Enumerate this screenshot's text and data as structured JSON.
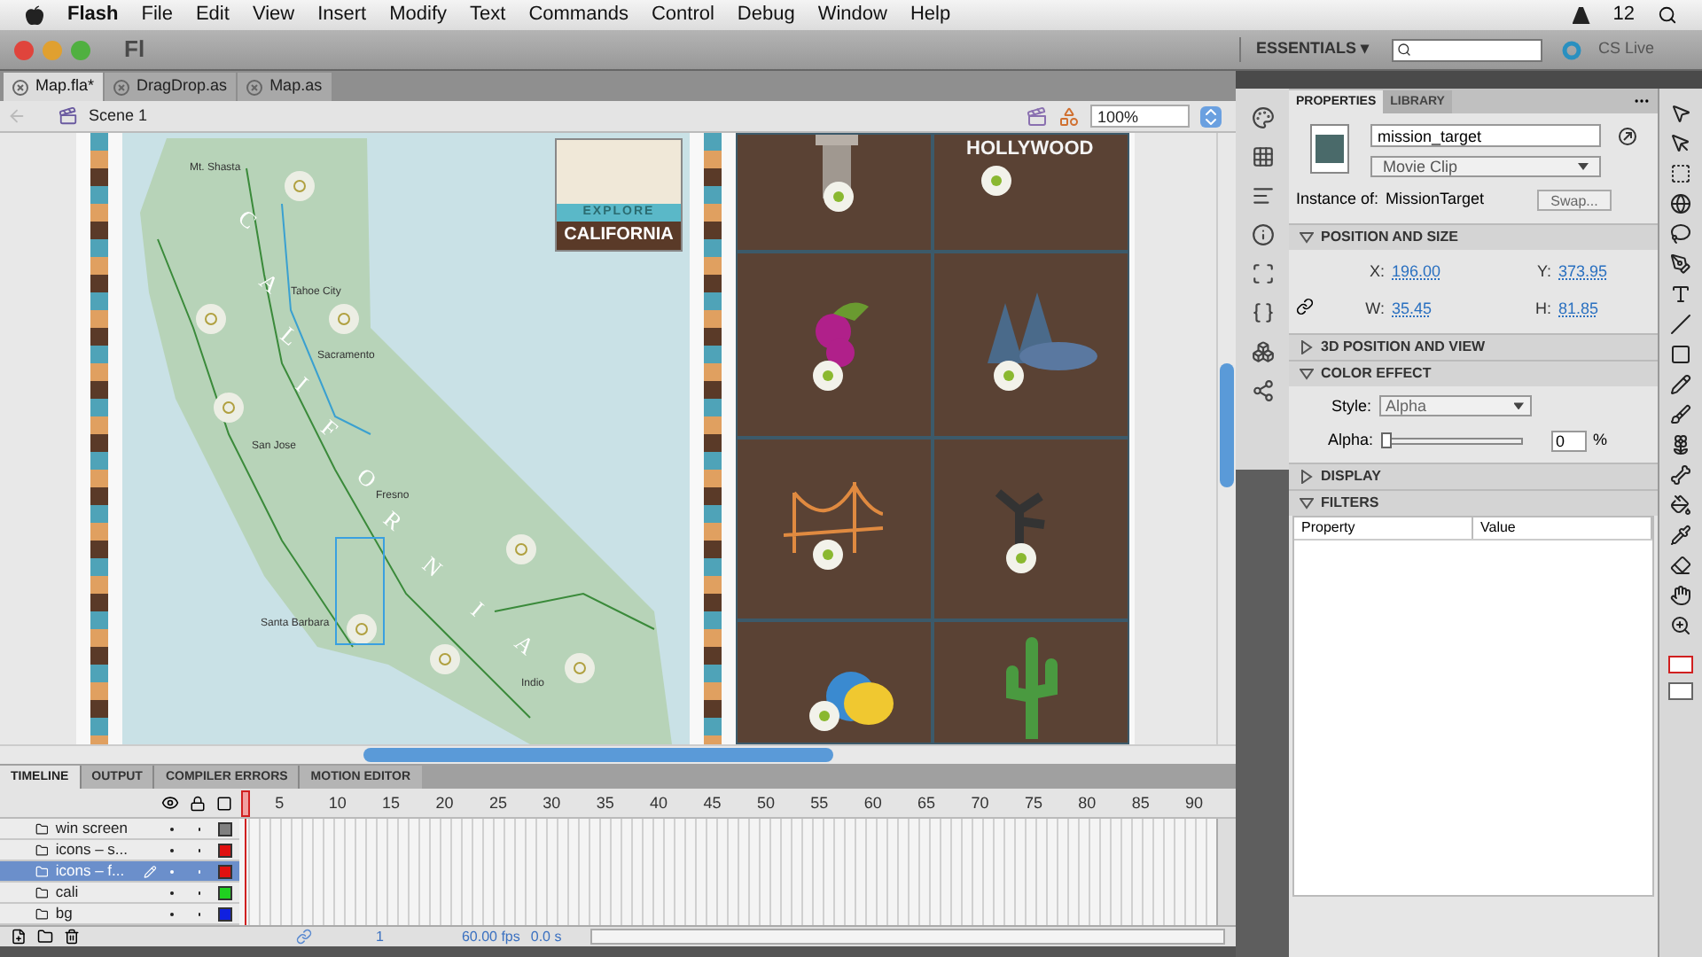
{
  "menu_bar": {
    "items": [
      "Flash",
      "File",
      "Edit",
      "View",
      "Insert",
      "Modify",
      "Text",
      "Commands",
      "Control",
      "Debug",
      "Window",
      "Help"
    ],
    "status": "12"
  },
  "title_bar": {
    "app_logo": "Fl",
    "workspace": "ESSENTIALS ▾",
    "cs_live": "CS Live"
  },
  "document_tabs": [
    {
      "label": "Map.fla*",
      "selected": true
    },
    {
      "label": "DragDrop.as",
      "selected": false
    },
    {
      "label": "Map.as",
      "selected": false
    }
  ],
  "edit_bar": {
    "scene": "Scene 1",
    "zoom": "100%"
  },
  "stage": {
    "map_lettering": [
      "C",
      "A",
      "L",
      "I",
      "F",
      "O",
      "R",
      "N",
      "I",
      "A"
    ],
    "cities": [
      "Mt. Shasta",
      "Tahoe City",
      "Sacramento",
      "San Jose",
      "Fresno",
      "Santa Barbara",
      "Indio"
    ],
    "badge_top": "EXPLORE",
    "badge_bottom": "CALIFORNIA",
    "hollywood_sign": "HOLLYWOOD"
  },
  "timeline": {
    "tabs": [
      {
        "label": "TIMELINE",
        "selected": true
      },
      {
        "label": "OUTPUT",
        "selected": false
      },
      {
        "label": "COMPILER ERRORS",
        "selected": false
      },
      {
        "label": "MOTION EDITOR",
        "selected": false
      }
    ],
    "frame_numbers": [
      "5",
      "10",
      "15",
      "20",
      "25",
      "30",
      "35",
      "40",
      "45",
      "50",
      "55",
      "60",
      "65",
      "70",
      "75",
      "80",
      "85",
      "90"
    ],
    "layers": [
      {
        "name": "win screen",
        "color": "#808080",
        "selected": false
      },
      {
        "name": "icons – s...",
        "color": "#e01010",
        "selected": false
      },
      {
        "name": "icons – f...",
        "color": "#e01010",
        "selected": true
      },
      {
        "name": "cali",
        "color": "#20d020",
        "selected": false
      },
      {
        "name": "bg",
        "color": "#1020e0",
        "selected": false
      }
    ],
    "current_frame": "1",
    "fps": "60.00 fps",
    "time": "0.0 s"
  },
  "properties": {
    "tabs": [
      {
        "label": "PROPERTIES",
        "selected": true
      },
      {
        "label": "LIBRARY",
        "selected": false
      }
    ],
    "instance_name": "mission_target",
    "symbol_type": "Movie Clip",
    "instance_of_label": "Instance of:",
    "instance_of": "MissionTarget",
    "swap": "Swap...",
    "sections": [
      {
        "kind": "position",
        "title": "POSITION AND SIZE",
        "expanded": true,
        "fields": [
          {
            "label": "X:",
            "value": "196.00"
          },
          {
            "label": "Y:",
            "value": "373.95"
          },
          {
            "label": "W:",
            "value": "35.45"
          },
          {
            "label": "H:",
            "value": "81.85"
          }
        ]
      },
      {
        "kind": "header",
        "title": "3D POSITION AND VIEW",
        "expanded": false
      },
      {
        "kind": "color",
        "title": "COLOR EFFECT",
        "expanded": true,
        "style_label": "Style:",
        "style": "Alpha",
        "alpha_label": "Alpha:",
        "alpha": {
          "level": 0,
          "value": "0",
          "unit": "%"
        }
      },
      {
        "kind": "header",
        "title": "DISPLAY",
        "expanded": false
      },
      {
        "kind": "filters",
        "title": "FILTERS",
        "expanded": true,
        "columns": [
          "Property",
          "Value"
        ]
      }
    ]
  }
}
